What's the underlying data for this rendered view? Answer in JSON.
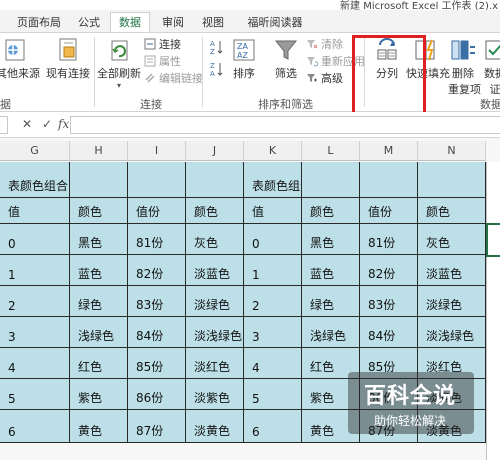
{
  "window": {
    "title": "新建 Microsoft Excel 工作表 (2).x"
  },
  "tabs": [
    {
      "label": "页面布局"
    },
    {
      "label": "公式"
    },
    {
      "label": "数据"
    },
    {
      "label": "审阅"
    },
    {
      "label": "视图"
    },
    {
      "label": "福昕阅读器"
    }
  ],
  "ribbon": {
    "get_external": {
      "other_sources": "其他来源",
      "existing_connection": "现有连接",
      "group_label": "据"
    },
    "connections": {
      "refresh_all": "全部刷新",
      "connections": "连接",
      "properties": "属性",
      "edit_links": "编辑链接",
      "group_label": "连接"
    },
    "sort_filter": {
      "sort": "排序",
      "filter": "筛选",
      "clear": "清除",
      "reapply": "重新应用",
      "advanced": "高级",
      "group_label": "排序和筛选"
    },
    "data_tools": {
      "text_to_columns": "分列",
      "flash_fill": "快速填充",
      "remove_duplicates_1": "删除",
      "remove_duplicates_2": "重复项",
      "data_validation_1": "数据",
      "data_validation_2": "证",
      "group_label": "数据"
    }
  },
  "formula_bar": {
    "cancel": "✕",
    "enter": "✓",
    "fx": "fx",
    "value": ""
  },
  "columns": [
    "G",
    "H",
    "I",
    "J",
    "K",
    "L",
    "M",
    "N"
  ],
  "rows": [
    [
      "表颜色组合",
      "",
      "",
      "",
      "表颜色组合",
      "",
      "",
      ""
    ],
    [
      "值",
      "颜色",
      "值份",
      "颜色",
      "值",
      "颜色",
      "值份",
      "颜色"
    ],
    [
      "0",
      "黑色",
      "81份",
      "灰色",
      "0",
      "黑色",
      "81份",
      "灰色"
    ],
    [
      "1",
      "蓝色",
      "82份",
      "淡蓝色",
      "1",
      "蓝色",
      "82份",
      "淡蓝色"
    ],
    [
      "2",
      "绿色",
      "83份",
      "淡绿色",
      "2",
      "绿色",
      "83份",
      "淡绿色"
    ],
    [
      "3",
      "浅绿色",
      "84份",
      "淡浅绿色",
      "3",
      "浅绿色",
      "84份",
      "淡浅绿色"
    ],
    [
      "4",
      "红色",
      "85份",
      "淡红色",
      "4",
      "红色",
      "85份",
      "淡红色"
    ],
    [
      "5",
      "紫色",
      "86份",
      "淡紫色",
      "5",
      "紫色",
      "86份",
      "淡紫色"
    ],
    [
      "6",
      "黄色",
      "87份",
      "淡黄色",
      "6",
      "黄色",
      "87份",
      "淡黄色"
    ]
  ],
  "watermark": {
    "title": "百科全说",
    "subtitle": "助你轻松解决"
  },
  "colors": {
    "cell_fill": "#bde0e8",
    "highlight": "#e02020",
    "accent": "#217346"
  }
}
